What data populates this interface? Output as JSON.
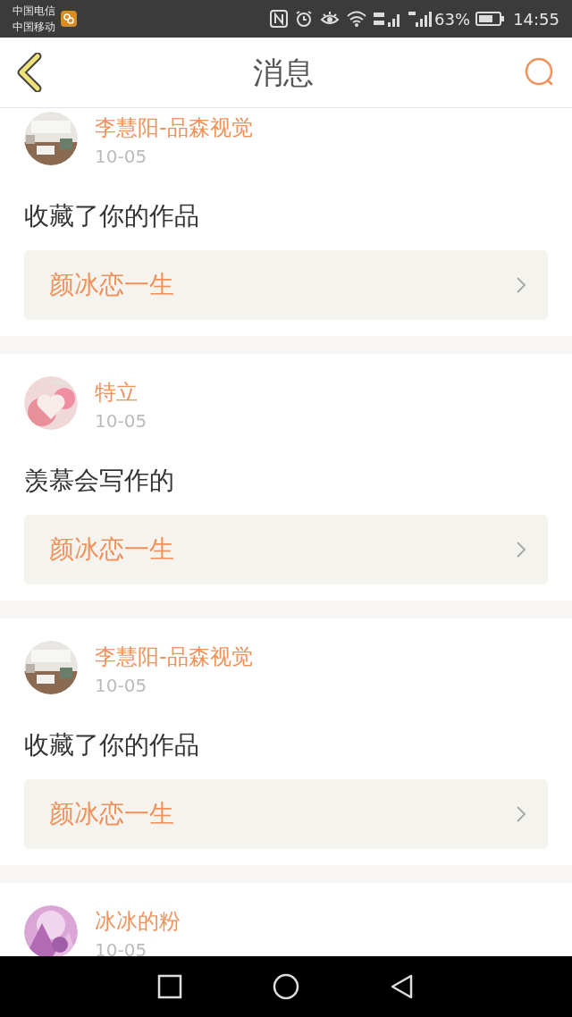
{
  "status_bar": {
    "carriers": [
      "中国电信",
      "中国移动"
    ],
    "battery": "63%",
    "time": "14:55"
  },
  "header": {
    "title": "消息"
  },
  "messages": [
    {
      "name": "李慧阳-品森视觉",
      "date": "10-05",
      "text": "收藏了你的作品",
      "work": "颜冰恋一生"
    },
    {
      "name": "特立",
      "date": "10-05",
      "text": "羡慕会写作的",
      "work": "颜冰恋一生"
    },
    {
      "name": "李慧阳-品森视觉",
      "date": "10-05",
      "text": "收藏了你的作品",
      "work": "颜冰恋一生"
    },
    {
      "name": "冰冰的粉",
      "date": "10-05"
    }
  ]
}
